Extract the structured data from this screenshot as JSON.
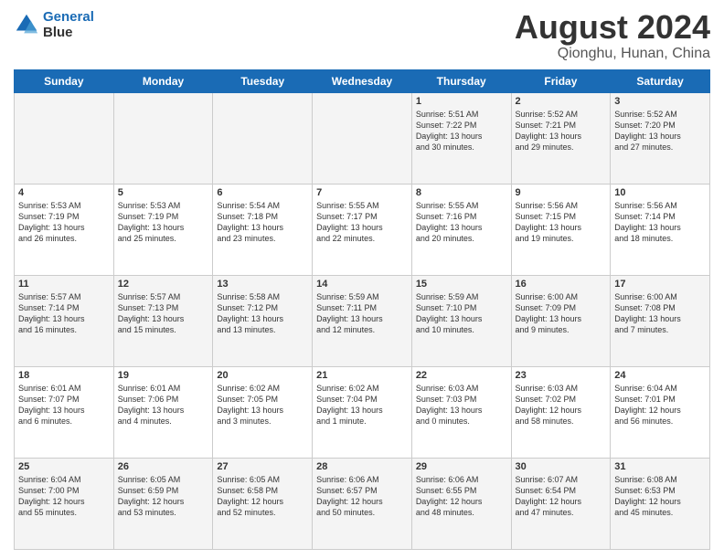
{
  "logo": {
    "line1": "General",
    "line2": "Blue"
  },
  "title": "August 2024",
  "subtitle": "Qionghu, Hunan, China",
  "days_header": [
    "Sunday",
    "Monday",
    "Tuesday",
    "Wednesday",
    "Thursday",
    "Friday",
    "Saturday"
  ],
  "weeks": [
    [
      {
        "day": "",
        "info": ""
      },
      {
        "day": "",
        "info": ""
      },
      {
        "day": "",
        "info": ""
      },
      {
        "day": "",
        "info": ""
      },
      {
        "day": "1",
        "info": "Sunrise: 5:51 AM\nSunset: 7:22 PM\nDaylight: 13 hours\nand 30 minutes."
      },
      {
        "day": "2",
        "info": "Sunrise: 5:52 AM\nSunset: 7:21 PM\nDaylight: 13 hours\nand 29 minutes."
      },
      {
        "day": "3",
        "info": "Sunrise: 5:52 AM\nSunset: 7:20 PM\nDaylight: 13 hours\nand 27 minutes."
      }
    ],
    [
      {
        "day": "4",
        "info": "Sunrise: 5:53 AM\nSunset: 7:19 PM\nDaylight: 13 hours\nand 26 minutes."
      },
      {
        "day": "5",
        "info": "Sunrise: 5:53 AM\nSunset: 7:19 PM\nDaylight: 13 hours\nand 25 minutes."
      },
      {
        "day": "6",
        "info": "Sunrise: 5:54 AM\nSunset: 7:18 PM\nDaylight: 13 hours\nand 23 minutes."
      },
      {
        "day": "7",
        "info": "Sunrise: 5:55 AM\nSunset: 7:17 PM\nDaylight: 13 hours\nand 22 minutes."
      },
      {
        "day": "8",
        "info": "Sunrise: 5:55 AM\nSunset: 7:16 PM\nDaylight: 13 hours\nand 20 minutes."
      },
      {
        "day": "9",
        "info": "Sunrise: 5:56 AM\nSunset: 7:15 PM\nDaylight: 13 hours\nand 19 minutes."
      },
      {
        "day": "10",
        "info": "Sunrise: 5:56 AM\nSunset: 7:14 PM\nDaylight: 13 hours\nand 18 minutes."
      }
    ],
    [
      {
        "day": "11",
        "info": "Sunrise: 5:57 AM\nSunset: 7:14 PM\nDaylight: 13 hours\nand 16 minutes."
      },
      {
        "day": "12",
        "info": "Sunrise: 5:57 AM\nSunset: 7:13 PM\nDaylight: 13 hours\nand 15 minutes."
      },
      {
        "day": "13",
        "info": "Sunrise: 5:58 AM\nSunset: 7:12 PM\nDaylight: 13 hours\nand 13 minutes."
      },
      {
        "day": "14",
        "info": "Sunrise: 5:59 AM\nSunset: 7:11 PM\nDaylight: 13 hours\nand 12 minutes."
      },
      {
        "day": "15",
        "info": "Sunrise: 5:59 AM\nSunset: 7:10 PM\nDaylight: 13 hours\nand 10 minutes."
      },
      {
        "day": "16",
        "info": "Sunrise: 6:00 AM\nSunset: 7:09 PM\nDaylight: 13 hours\nand 9 minutes."
      },
      {
        "day": "17",
        "info": "Sunrise: 6:00 AM\nSunset: 7:08 PM\nDaylight: 13 hours\nand 7 minutes."
      }
    ],
    [
      {
        "day": "18",
        "info": "Sunrise: 6:01 AM\nSunset: 7:07 PM\nDaylight: 13 hours\nand 6 minutes."
      },
      {
        "day": "19",
        "info": "Sunrise: 6:01 AM\nSunset: 7:06 PM\nDaylight: 13 hours\nand 4 minutes."
      },
      {
        "day": "20",
        "info": "Sunrise: 6:02 AM\nSunset: 7:05 PM\nDaylight: 13 hours\nand 3 minutes."
      },
      {
        "day": "21",
        "info": "Sunrise: 6:02 AM\nSunset: 7:04 PM\nDaylight: 13 hours\nand 1 minute."
      },
      {
        "day": "22",
        "info": "Sunrise: 6:03 AM\nSunset: 7:03 PM\nDaylight: 13 hours\nand 0 minutes."
      },
      {
        "day": "23",
        "info": "Sunrise: 6:03 AM\nSunset: 7:02 PM\nDaylight: 12 hours\nand 58 minutes."
      },
      {
        "day": "24",
        "info": "Sunrise: 6:04 AM\nSunset: 7:01 PM\nDaylight: 12 hours\nand 56 minutes."
      }
    ],
    [
      {
        "day": "25",
        "info": "Sunrise: 6:04 AM\nSunset: 7:00 PM\nDaylight: 12 hours\nand 55 minutes."
      },
      {
        "day": "26",
        "info": "Sunrise: 6:05 AM\nSunset: 6:59 PM\nDaylight: 12 hours\nand 53 minutes."
      },
      {
        "day": "27",
        "info": "Sunrise: 6:05 AM\nSunset: 6:58 PM\nDaylight: 12 hours\nand 52 minutes."
      },
      {
        "day": "28",
        "info": "Sunrise: 6:06 AM\nSunset: 6:57 PM\nDaylight: 12 hours\nand 50 minutes."
      },
      {
        "day": "29",
        "info": "Sunrise: 6:06 AM\nSunset: 6:55 PM\nDaylight: 12 hours\nand 48 minutes."
      },
      {
        "day": "30",
        "info": "Sunrise: 6:07 AM\nSunset: 6:54 PM\nDaylight: 12 hours\nand 47 minutes."
      },
      {
        "day": "31",
        "info": "Sunrise: 6:08 AM\nSunset: 6:53 PM\nDaylight: 12 hours\nand 45 minutes."
      }
    ]
  ]
}
